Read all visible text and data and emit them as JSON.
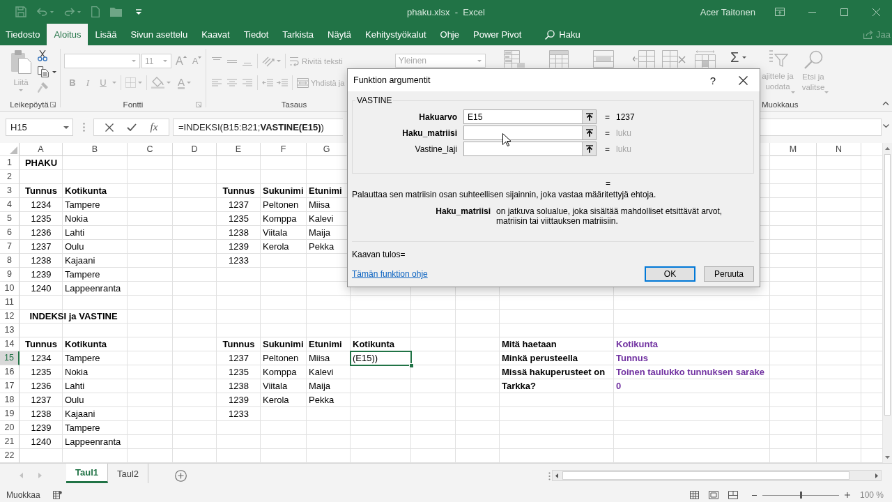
{
  "window": {
    "title": "phaku.xlsx  -  Excel",
    "user": "Acer Taitonen"
  },
  "ribbon_tabs": [
    {
      "label": "Tiedosto",
      "selected": false
    },
    {
      "label": "Aloitus",
      "selected": true
    },
    {
      "label": "Lisää",
      "selected": false
    },
    {
      "label": "Sivun asettelu",
      "selected": false
    },
    {
      "label": "Kaavat",
      "selected": false
    },
    {
      "label": "Tiedot",
      "selected": false
    },
    {
      "label": "Tarkista",
      "selected": false
    },
    {
      "label": "Näytä",
      "selected": false
    },
    {
      "label": "Kehitystyökalut",
      "selected": false
    },
    {
      "label": "Ohje",
      "selected": false
    },
    {
      "label": "Power Pivot",
      "selected": false
    }
  ],
  "search": {
    "label": "Haku"
  },
  "share": {
    "label": "Jaa"
  },
  "ribbon": {
    "clipboard": {
      "paste": {
        "label": "Liitä",
        "disabled": true
      },
      "label": "Leikepöytä"
    },
    "font": {
      "size": {
        "label": "11",
        "disabled": true
      },
      "grow": {
        "label": "A",
        "disabled": true
      },
      "shrink": {
        "label": "A",
        "disabled": true
      },
      "format_buttons": [
        {
          "kind": "bold",
          "label": "B",
          "disabled": true
        },
        {
          "kind": "italic",
          "label": "I",
          "disabled": true
        },
        {
          "kind": "underline",
          "label": "U",
          "disabled": true
        }
      ],
      "color_button": {
        "label": "A",
        "disabled": true
      },
      "label": "Fontti"
    },
    "alignment": {
      "wrap_text": {
        "label": "Rivitä teksti",
        "disabled": true
      },
      "merge": {
        "label": "Yhdistä ja",
        "disabled": true
      },
      "label": "Tasaus"
    },
    "number": {
      "format": {
        "label": "Yleinen",
        "disabled": true
      }
    },
    "editing": {
      "autosum": {
        "label": "Σ",
        "disabled": false
      },
      "sort_filter": {
        "lines": [
          "ajittele ja",
          "uodata"
        ],
        "disabled": true
      },
      "find_select": {
        "lines": [
          "Etsi ja",
          "valitse"
        ],
        "disabled": true
      },
      "label": "Muokkaus"
    }
  },
  "formula_bar": {
    "name_box": "H15",
    "insert_function": "fx",
    "formula": "=INDEKSI(B15:B21;**VASTINE(E15)**)"
  },
  "sheet": {
    "columns": [
      "A",
      "B",
      "C",
      "D",
      "E",
      "F",
      "G",
      "M",
      "N"
    ],
    "rows": [
      {
        "number": "1",
        "selected": false,
        "kind": "title",
        "cells": [
          {
            "text": "PHAKU",
            "selected": false
          }
        ]
      },
      {
        "number": "2",
        "selected": false
      },
      {
        "number": "3",
        "selected": false,
        "kind": "header",
        "cells": [
          {
            "text": "Tunnus",
            "selected": false
          },
          {
            "text": "Kotikunta",
            "selected": false
          },
          null,
          null,
          {
            "text": "Tunnus",
            "selected": false
          },
          {
            "text": "Sukunimi",
            "selected": false
          },
          {
            "text": "Etunimi",
            "selected": false
          }
        ]
      },
      {
        "number": "4",
        "selected": false,
        "kind": "data",
        "cells": [
          {
            "text": "1234",
            "selected": false
          },
          {
            "text": "Tampere",
            "selected": false
          },
          null,
          null,
          {
            "text": "1237",
            "selected": false
          },
          {
            "text": "Peltonen",
            "selected": false
          },
          {
            "text": "Miisa",
            "selected": false
          }
        ]
      },
      {
        "number": "5",
        "selected": false,
        "kind": "data",
        "cells": [
          {
            "text": "1235",
            "selected": false
          },
          {
            "text": "Nokia",
            "selected": false
          },
          null,
          null,
          {
            "text": "1235",
            "selected": false
          },
          {
            "text": "Komppa",
            "selected": false
          },
          {
            "text": "Kalevi",
            "selected": false
          }
        ]
      },
      {
        "number": "6",
        "selected": false,
        "kind": "data",
        "cells": [
          {
            "text": "1236",
            "selected": false
          },
          {
            "text": "Lahti",
            "selected": false
          },
          null,
          null,
          {
            "text": "1238",
            "selected": false
          },
          {
            "text": "Viitala",
            "selected": false
          },
          {
            "text": "Maija",
            "selected": false
          }
        ]
      },
      {
        "number": "7",
        "selected": false,
        "kind": "data",
        "cells": [
          {
            "text": "1237",
            "selected": false
          },
          {
            "text": "Oulu",
            "selected": false
          },
          null,
          null,
          {
            "text": "1239",
            "selected": false
          },
          {
            "text": "Kerola",
            "selected": false
          },
          {
            "text": "Pekka",
            "selected": false
          }
        ]
      },
      {
        "number": "8",
        "selected": false,
        "kind": "data",
        "cells": [
          {
            "text": "1238",
            "selected": false
          },
          {
            "text": "Kajaani",
            "selected": false
          },
          null,
          null,
          {
            "text": "1233",
            "selected": false
          }
        ]
      },
      {
        "number": "9",
        "selected": false,
        "kind": "data",
        "cells": [
          {
            "text": "1239",
            "selected": false
          },
          {
            "text": "Tampere",
            "selected": false
          }
        ]
      },
      {
        "number": "10",
        "selected": false,
        "kind": "data",
        "cells": [
          {
            "text": "1240",
            "selected": false
          },
          {
            "text": "Lappeenranta",
            "selected": false
          }
        ]
      },
      {
        "number": "11",
        "selected": false
      },
      {
        "number": "12",
        "selected": false,
        "kind": "merged_title",
        "cells": [
          {
            "text": "INDEKSI ja VASTINE",
            "selected": false
          }
        ]
      },
      {
        "number": "13",
        "selected": false
      },
      {
        "number": "14",
        "selected": false,
        "kind": "header",
        "cells": [
          {
            "text": "Tunnus",
            "selected": false
          },
          {
            "text": "Kotikunta",
            "selected": false
          },
          null,
          null,
          {
            "text": "Tunnus",
            "selected": false
          },
          {
            "text": "Sukunimi",
            "selected": false
          },
          {
            "text": "Etunimi",
            "selected": false
          },
          {
            "text": "Kotikunta",
            "selected": false
          },
          null,
          null,
          {
            "text": "Mitä haetaan",
            "selected": false
          },
          {
            "text": "Kotikunta",
            "selected": false
          }
        ]
      },
      {
        "number": "15",
        "selected": true,
        "kind": "data",
        "cells": [
          {
            "text": "1234",
            "selected": false
          },
          {
            "text": "Tampere",
            "selected": false
          },
          null,
          null,
          {
            "text": "1237",
            "selected": false
          },
          {
            "text": "Peltonen",
            "selected": false
          },
          {
            "text": "Miisa",
            "selected": false
          },
          {
            "text": "(E15))",
            "selected": true
          },
          null,
          null,
          {
            "text": "Minkä perusteella",
            "selected": false
          },
          {
            "text": "Tunnus",
            "selected": false
          }
        ]
      },
      {
        "number": "16",
        "selected": false,
        "kind": "data",
        "cells": [
          {
            "text": "1235",
            "selected": false
          },
          {
            "text": "Nokia",
            "selected": false
          },
          null,
          null,
          {
            "text": "1235",
            "selected": false
          },
          {
            "text": "Komppa",
            "selected": false
          },
          {
            "text": "Kalevi",
            "selected": false
          },
          null,
          null,
          null,
          {
            "text": "Missä hakuperusteet on",
            "selected": false
          },
          {
            "text": "Toinen taulukko tunnuksen sarake",
            "selected": false
          }
        ]
      },
      {
        "number": "17",
        "selected": false,
        "kind": "data",
        "cells": [
          {
            "text": "1236",
            "selected": false
          },
          {
            "text": "Lahti",
            "selected": false
          },
          null,
          null,
          {
            "text": "1238",
            "selected": false
          },
          {
            "text": "Viitala",
            "selected": false
          },
          {
            "text": "Maija",
            "selected": false
          },
          null,
          null,
          null,
          {
            "text": "Tarkka?",
            "selected": false
          },
          {
            "text": "0",
            "selected": false
          }
        ]
      },
      {
        "number": "18",
        "selected": false,
        "kind": "data",
        "cells": [
          {
            "text": "1237",
            "selected": false
          },
          {
            "text": "Oulu",
            "selected": false
          },
          null,
          null,
          {
            "text": "1239",
            "selected": false
          },
          {
            "text": "Kerola",
            "selected": false
          },
          {
            "text": "Pekka",
            "selected": false
          }
        ]
      },
      {
        "number": "19",
        "selected": false,
        "kind": "data",
        "cells": [
          {
            "text": "1238",
            "selected": false
          },
          {
            "text": "Kajaani",
            "selected": false
          },
          null,
          null,
          {
            "text": "1233",
            "selected": false
          }
        ]
      },
      {
        "number": "20",
        "selected": false,
        "kind": "data",
        "cells": [
          {
            "text": "1239",
            "selected": false
          },
          {
            "text": "Tampere",
            "selected": false
          }
        ]
      },
      {
        "number": "21",
        "selected": false,
        "kind": "data",
        "cells": [
          {
            "text": "1240",
            "selected": false
          },
          {
            "text": "Lappeenranta",
            "selected": false
          }
        ]
      },
      {
        "number": "22",
        "selected": false
      }
    ]
  },
  "dialog": {
    "title": "Funktion argumentit",
    "help": "?",
    "function_name": "VASTINE",
    "arguments": [
      {
        "label": "Hakuarvo",
        "required": true,
        "value": "E15",
        "equals": "=",
        "result": "1237",
        "hint": false
      },
      {
        "label": "Haku_matriisi",
        "required": true,
        "equals": "=",
        "result": "luku",
        "hint": true
      },
      {
        "label": "Vastine_laji",
        "required": false,
        "equals": "=",
        "result": "luku",
        "hint": true
      }
    ],
    "function_result": {
      "equals": "="
    },
    "description": "Palauttaa sen matriisin osan suhteellisen sijainnin, joka vastaa määritettyjä ehtoja.",
    "argument_help": {
      "name": "Haku_matriisi",
      "text": "on jatkuva solualue, joka sisältää mahdolliset etsittävät arvot, matriisin tai viittauksen matriisiin."
    },
    "formula_result": "Kaavan tulos=",
    "help_link": "Tämän funktion ohje",
    "buttons": [
      {
        "label": "OK",
        "focused": true
      },
      {
        "label": "Peruuta",
        "focused": false
      }
    ]
  },
  "sheet_tabs": [
    {
      "label": "Taul1",
      "selected": true
    },
    {
      "label": "Taul2",
      "selected": false
    }
  ],
  "status_bar": {
    "mode": "Muokkaa",
    "zoom": {
      "level": 0.5,
      "label": "100 %"
    }
  }
}
